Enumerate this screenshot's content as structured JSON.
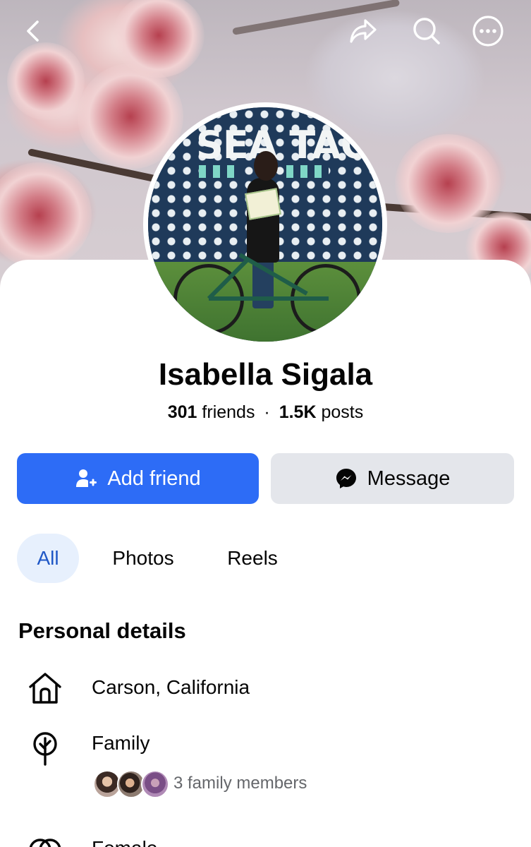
{
  "header": {
    "back_icon": "chevron-left-icon",
    "share_icon": "share-icon",
    "search_icon": "search-icon",
    "more_icon": "more-icon"
  },
  "cover_photo": {
    "description_icon": "cherry-blossom-cover"
  },
  "profile_photo": {
    "logo_text": "SEA TAC"
  },
  "profile": {
    "name": "Isabella Sigala",
    "friends_count": "301",
    "friends_label": "friends",
    "separator": "·",
    "posts_count": "1.5K",
    "posts_label": "posts"
  },
  "actions": {
    "add_friend_label": "Add friend",
    "message_label": "Message"
  },
  "tabs": [
    {
      "label": "All",
      "selected": true
    },
    {
      "label": "Photos",
      "selected": false
    },
    {
      "label": "Reels",
      "selected": false
    }
  ],
  "personal_details": {
    "title": "Personal details",
    "location": "Carson, California",
    "family_label": "Family",
    "family_members": "3 family members",
    "gender": "Female"
  },
  "colors": {
    "accent": "#2d6cf6",
    "tab_selected_bg": "#e7f0fd",
    "tab_selected_text": "#1f57c6",
    "secondary_button": "#e4e6eb",
    "muted_text": "#65676b"
  }
}
